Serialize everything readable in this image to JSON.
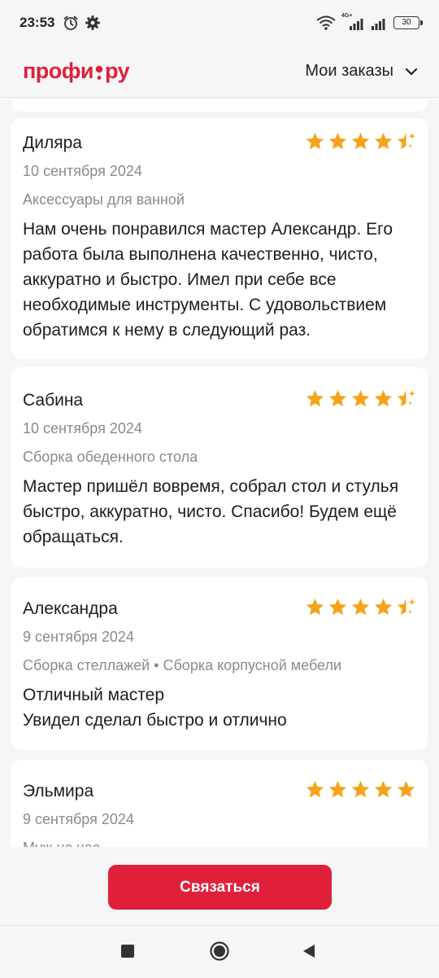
{
  "status": {
    "time": "23:53",
    "network": "4G+",
    "battery": "30"
  },
  "header": {
    "logo_left": "профи",
    "logo_right": "ру",
    "orders_label": "Мои заказы"
  },
  "reviews": [
    {
      "name": "Диляра",
      "date": "10 сентября 2024",
      "category": "Аксессуары для ванной",
      "text": "Нам очень понравился мастер Александр. Его работа была выполнена качественно, чисто, аккуратно и быстро. Имел при себе все необходимые инструменты. С удовольствием обратимся к нему в следующий раз.",
      "rating": 4.5
    },
    {
      "name": "Сабина",
      "date": "10 сентября 2024",
      "category": "Сборка обеденного стола",
      "text": "Мастер пришёл вовремя, собрал стол и стулья быстро, аккуратно, чисто. Спасибо! Будем ещё обращаться.",
      "rating": 4.5
    },
    {
      "name": "Александра",
      "date": "9 сентября 2024",
      "category": "Сборка стеллажей • Сборка корпусной мебели",
      "text": "Отличный мастер\nУвидел сделал быстро и отлично",
      "rating": 4.5
    },
    {
      "name": "Эльмира",
      "date": "9 сентября 2024",
      "category": "Муж на час",
      "text": "",
      "rating": 5
    }
  ],
  "actions": {
    "contact_label": "Связаться"
  },
  "colors": {
    "brand_red": "#e0203a",
    "star_orange": "#f5a31a"
  }
}
